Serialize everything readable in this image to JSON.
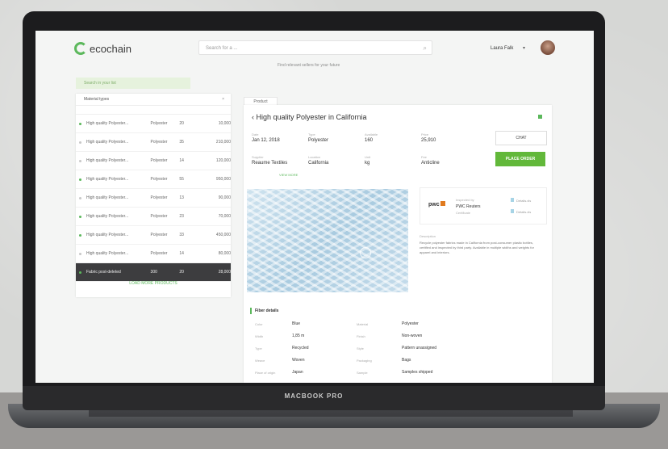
{
  "device": {
    "brand": "MACBOOK PRO"
  },
  "header": {
    "logo": "ecochain",
    "search_placeholder": "Search for a ...",
    "subtext": "Find relevant sellers for your future",
    "user_name": "Laura Falk"
  },
  "sidebar": {
    "filter_placeholder": "Search in your list",
    "panel_title": "Material types",
    "rows": [
      {
        "name": "High quality Polyester...",
        "material": "Polyester",
        "qty": "20",
        "price": "10,000",
        "active": true
      },
      {
        "name": "High quality Polyester...",
        "material": "Polyester",
        "qty": "35",
        "price": "210,000",
        "active": false
      },
      {
        "name": "High quality Polyester...",
        "material": "Polyester",
        "qty": "14",
        "price": "120,000",
        "active": false
      },
      {
        "name": "High quality Polyester...",
        "material": "Polyester",
        "qty": "55",
        "price": "950,000",
        "active": true
      },
      {
        "name": "High quality Polyester...",
        "material": "Polyester",
        "qty": "13",
        "price": "90,000",
        "active": false
      },
      {
        "name": "High quality Polyester...",
        "material": "Polyester",
        "qty": "23",
        "price": "70,000",
        "active": true
      },
      {
        "name": "High quality Polyester...",
        "material": "Polyester",
        "qty": "33",
        "price": "450,000",
        "active": true
      },
      {
        "name": "High quality Polyester...",
        "material": "Polyester",
        "qty": "14",
        "price": "80,000",
        "active": false
      },
      {
        "name": "Fabric post-deleted",
        "material": "300",
        "qty": "20",
        "price": "28,000",
        "active": true,
        "selected": true
      }
    ],
    "show_more": "LOAD MORE PRODUCTS"
  },
  "detail": {
    "tab": "Product",
    "title": "High quality Polyester in California",
    "meta_row1": [
      {
        "label": "Date",
        "value": "Jan 12, 2018"
      },
      {
        "label": "Type",
        "value": "Polyester"
      },
      {
        "label": "Available",
        "value": "160"
      },
      {
        "label": "Price",
        "value": "25,910"
      }
    ],
    "meta_row2": [
      {
        "label": "Supplier",
        "value": "Reaume Textiles"
      },
      {
        "label": "Location",
        "value": "California"
      },
      {
        "label": "Unit",
        "value": "kg"
      },
      {
        "label": "Fee",
        "value": "Anticline"
      }
    ],
    "view_more": "VIEW MORE",
    "chat_button": "CHAT",
    "order_button": "PLACE ORDER",
    "seller": {
      "logo": "pwc",
      "label": "Inspected by",
      "name": "PWC Reuters",
      "sub": "Certificate"
    },
    "docs": [
      "Details.xls",
      "Details.xls"
    ],
    "desc_title": "Description",
    "desc": "Recycle polyester fabrics made in California from post-consumer plastic bottles, certified and inspected by third party. Available in multiple widths and weights for apparel and interiors.",
    "section_title": "Fiber details",
    "fields": [
      {
        "label": "Color",
        "value": "Blue"
      },
      {
        "label": "Width",
        "value": "1,85 m"
      },
      {
        "label": "Type",
        "value": "Recycled"
      },
      {
        "label": "Weave",
        "value": "Woven"
      },
      {
        "label": "Place of origin",
        "value": "Japan"
      },
      {
        "label": "Material",
        "value": "Polyester"
      },
      {
        "label": "Finish",
        "value": "Non-woven"
      },
      {
        "label": "Style",
        "value": "Pattern unassigned"
      },
      {
        "label": "Packaging",
        "value": "Bags"
      },
      {
        "label": "Sample",
        "value": "Samples shipped"
      }
    ]
  }
}
